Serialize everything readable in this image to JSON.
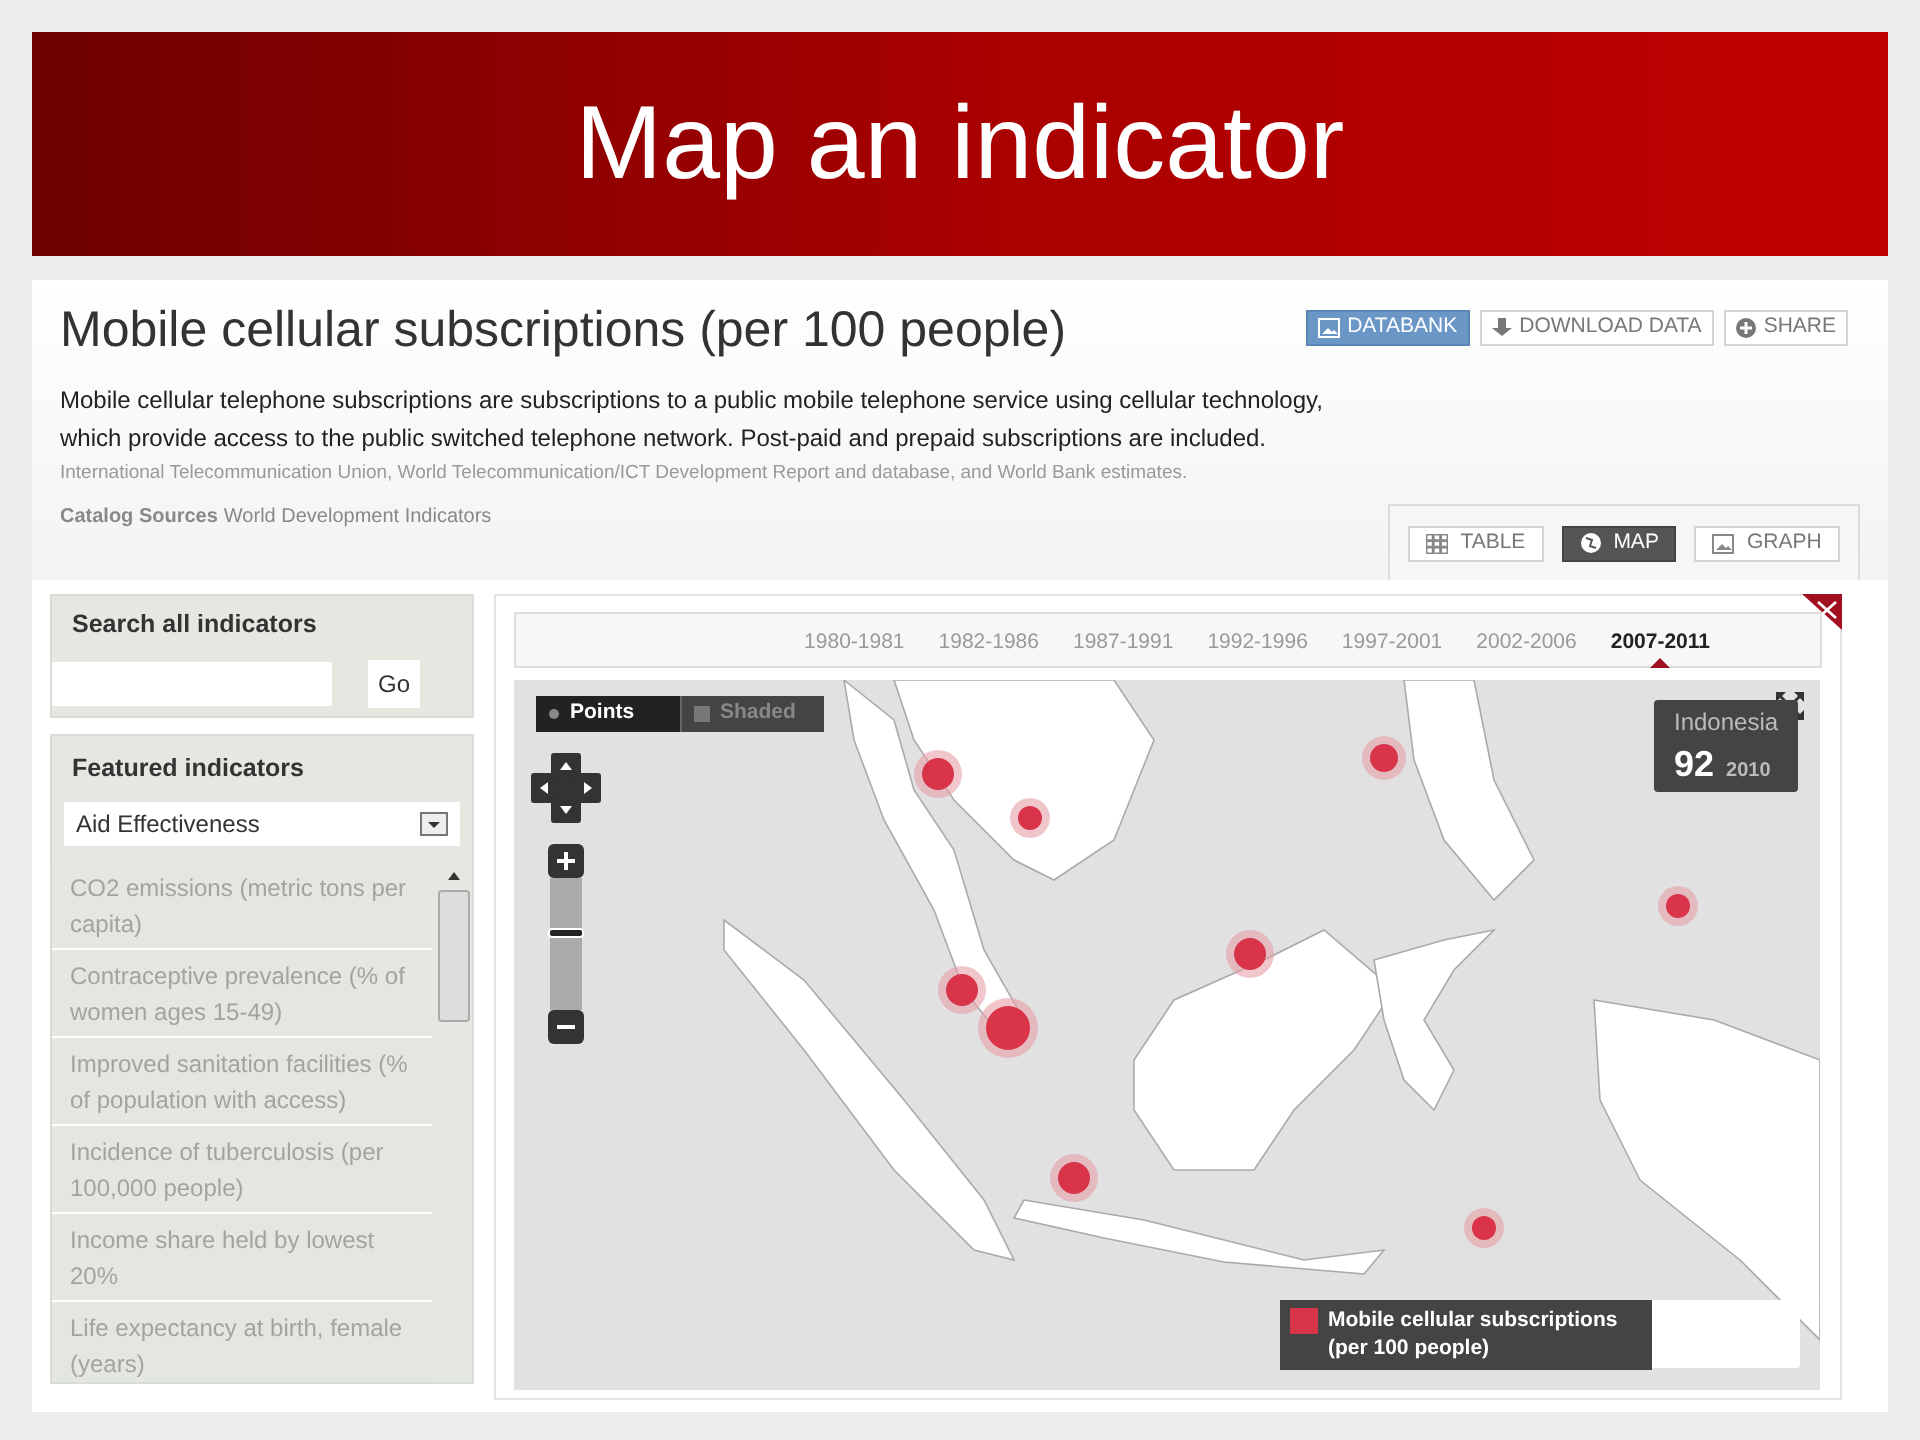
{
  "slide": {
    "title": "Map an indicator"
  },
  "page": {
    "title": "Mobile cellular subscriptions (per 100 people)",
    "actions": [
      {
        "label": "DATABANK",
        "kind": "databank"
      },
      {
        "label": "DOWNLOAD DATA",
        "kind": "download"
      },
      {
        "label": "SHARE",
        "kind": "share"
      }
    ],
    "description": "Mobile cellular telephone subscriptions are subscriptions to a public mobile telephone service using cellular technology, which provide access to the public switched telephone network. Post-paid and prepaid subscriptions are included.",
    "source": "International Telecommunication Union, World Telecommunication/ICT Development Report and database, and World Bank estimates.",
    "catalog": {
      "label": "Catalog Sources",
      "value": "World Development Indicators"
    }
  },
  "views": [
    {
      "label": "TABLE",
      "kind": "table",
      "selected": false
    },
    {
      "label": "MAP",
      "kind": "map",
      "selected": true
    },
    {
      "label": "GRAPH",
      "kind": "graph",
      "selected": false
    }
  ],
  "sidebar": {
    "search": {
      "title": "Search all indicators",
      "button": "Go"
    },
    "featured": {
      "title": "Featured indicators",
      "dropdown": "Aid Effectiveness",
      "items": [
        "CO2 emissions (metric tons per capita)",
        "Contraceptive prevalence (% of women ages 15-49)",
        "Improved sanitation facilities (% of population with access)",
        "Incidence of tuberculosis (per 100,000 people)",
        "Income share held by lowest 20%",
        "Life expectancy at birth, female (years)"
      ]
    }
  },
  "timeline": [
    {
      "label": "1980-1981",
      "selected": false
    },
    {
      "label": "1982-1986",
      "selected": false
    },
    {
      "label": "1987-1991",
      "selected": false
    },
    {
      "label": "1992-1996",
      "selected": false
    },
    {
      "label": "1997-2001",
      "selected": false
    },
    {
      "label": "2002-2006",
      "selected": false
    },
    {
      "label": "2007-2011",
      "selected": true
    }
  ],
  "map": {
    "modes": [
      {
        "label": "Points",
        "kind": "points",
        "selected": true
      },
      {
        "label": "Shaded",
        "kind": "shaded",
        "selected": false
      }
    ],
    "tooltip": {
      "country": "Indonesia",
      "value": "92",
      "year": "2010"
    },
    "legend": "Mobile cellular subscriptions (per 100 people)"
  }
}
